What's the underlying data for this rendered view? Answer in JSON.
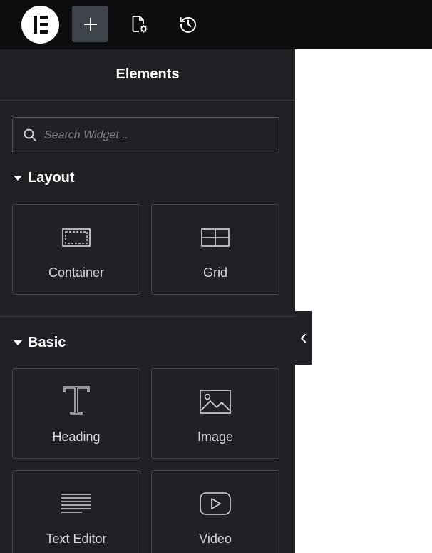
{
  "topbar": {
    "logo_icon": "elementor-logo-icon",
    "buttons": [
      {
        "icon": "plus-icon",
        "active": true
      },
      {
        "icon": "page-settings-icon",
        "active": false
      },
      {
        "icon": "history-icon",
        "active": false
      }
    ]
  },
  "panel": {
    "title": "Elements",
    "search": {
      "placeholder": "Search Widget..."
    },
    "categories": [
      {
        "label": "Layout",
        "expanded": true,
        "widgets": [
          {
            "label": "Container",
            "icon": "container-icon"
          },
          {
            "label": "Grid",
            "icon": "grid-icon"
          }
        ]
      },
      {
        "label": "Basic",
        "expanded": true,
        "widgets": [
          {
            "label": "Heading",
            "icon": "heading-icon"
          },
          {
            "label": "Image",
            "icon": "image-icon"
          },
          {
            "label": "Text Editor",
            "icon": "text-editor-icon"
          },
          {
            "label": "Video",
            "icon": "video-icon"
          }
        ]
      }
    ],
    "collapse_icon": "chevron-left-icon"
  },
  "colors": {
    "topbar_bg": "#0c0d0e",
    "panel_bg": "#1f2124",
    "active_button_bg": "#3f444b",
    "tile_border": "#3f444b",
    "text": "#d5d8dc",
    "canvas_bg": "#ffffff"
  }
}
